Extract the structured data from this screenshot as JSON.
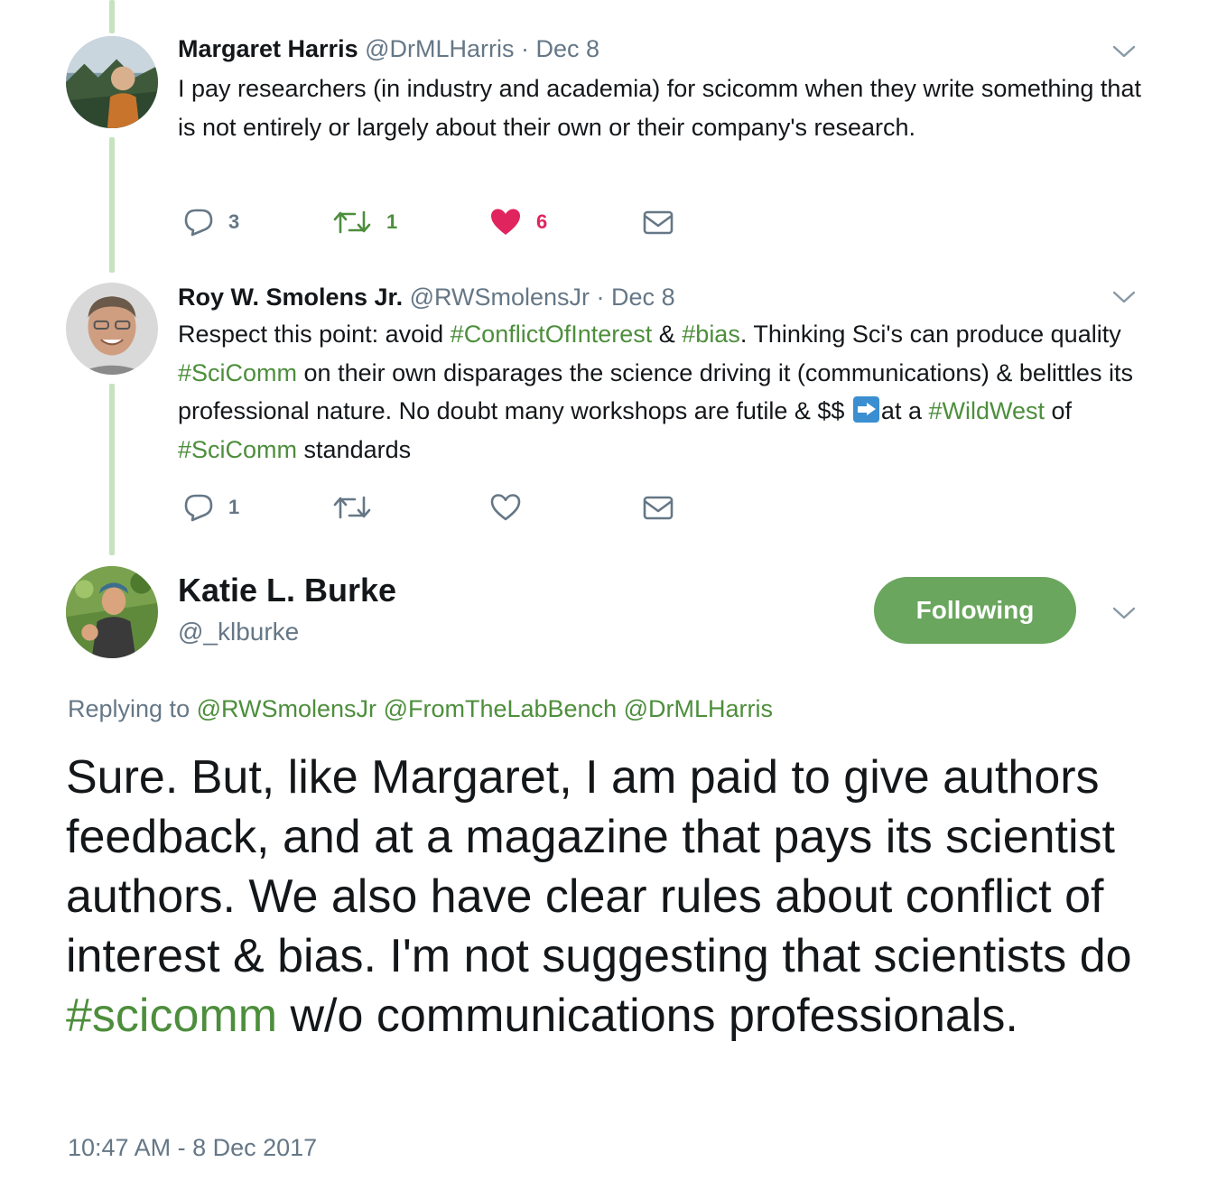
{
  "tweets": [
    {
      "name": "Margaret Harris",
      "handle": "@DrMLHarris",
      "sep": " · ",
      "date": "Dec 8",
      "text": "I pay researchers (in industry and academia) for scicomm when they write something that is not entirely or largely about their own or their company's research.",
      "replies": "3",
      "retweets": "1",
      "likes": "6"
    },
    {
      "name": "Roy W. Smolens Jr.",
      "handle": "@RWSmolensJr",
      "sep": " · ",
      "date": "Dec 8",
      "text_parts": [
        "Respect this point: avoid ",
        "#ConflictOfInterest",
        " & ",
        "#bias",
        ". Thinking Sci's can produce quality ",
        "#SciComm",
        " on their own disparages the science driving it (communications) & belittles its professional nature. No doubt many workshops are futile & $$ ",
        "at a ",
        "#WildWest",
        " of ",
        "#SciComm",
        " standards"
      ],
      "replies": "1"
    }
  ],
  "main": {
    "name": "Katie L. Burke",
    "handle": "@_klburke",
    "follow_label": "Following",
    "replying_prefix": "Replying to ",
    "mentions": [
      "@RWSmolensJr",
      "@FromTheLabBench",
      "@DrMLHarris"
    ],
    "text_before": "Sure. But, like Margaret, I am paid to give authors feedback, and at a magazine that pays its scientist authors. We also have clear rules about conflict of interest & bias. I'm not suggesting that scientists do ",
    "hashtag": "#scicomm",
    "text_after": " w/o communications professionals.",
    "timestamp": "10:47 AM - 8 Dec 2017"
  },
  "colors": {
    "accent": "#4d8e3c",
    "like": "#e0245e",
    "follow_button": "#6aa65e",
    "thread_line": "#c6e2bf",
    "muted": "#657786"
  },
  "icons": [
    "reply-icon",
    "retweet-icon",
    "like-icon",
    "direct-message-icon",
    "chevron-down-icon",
    "arrow-right-emoji-icon"
  ]
}
